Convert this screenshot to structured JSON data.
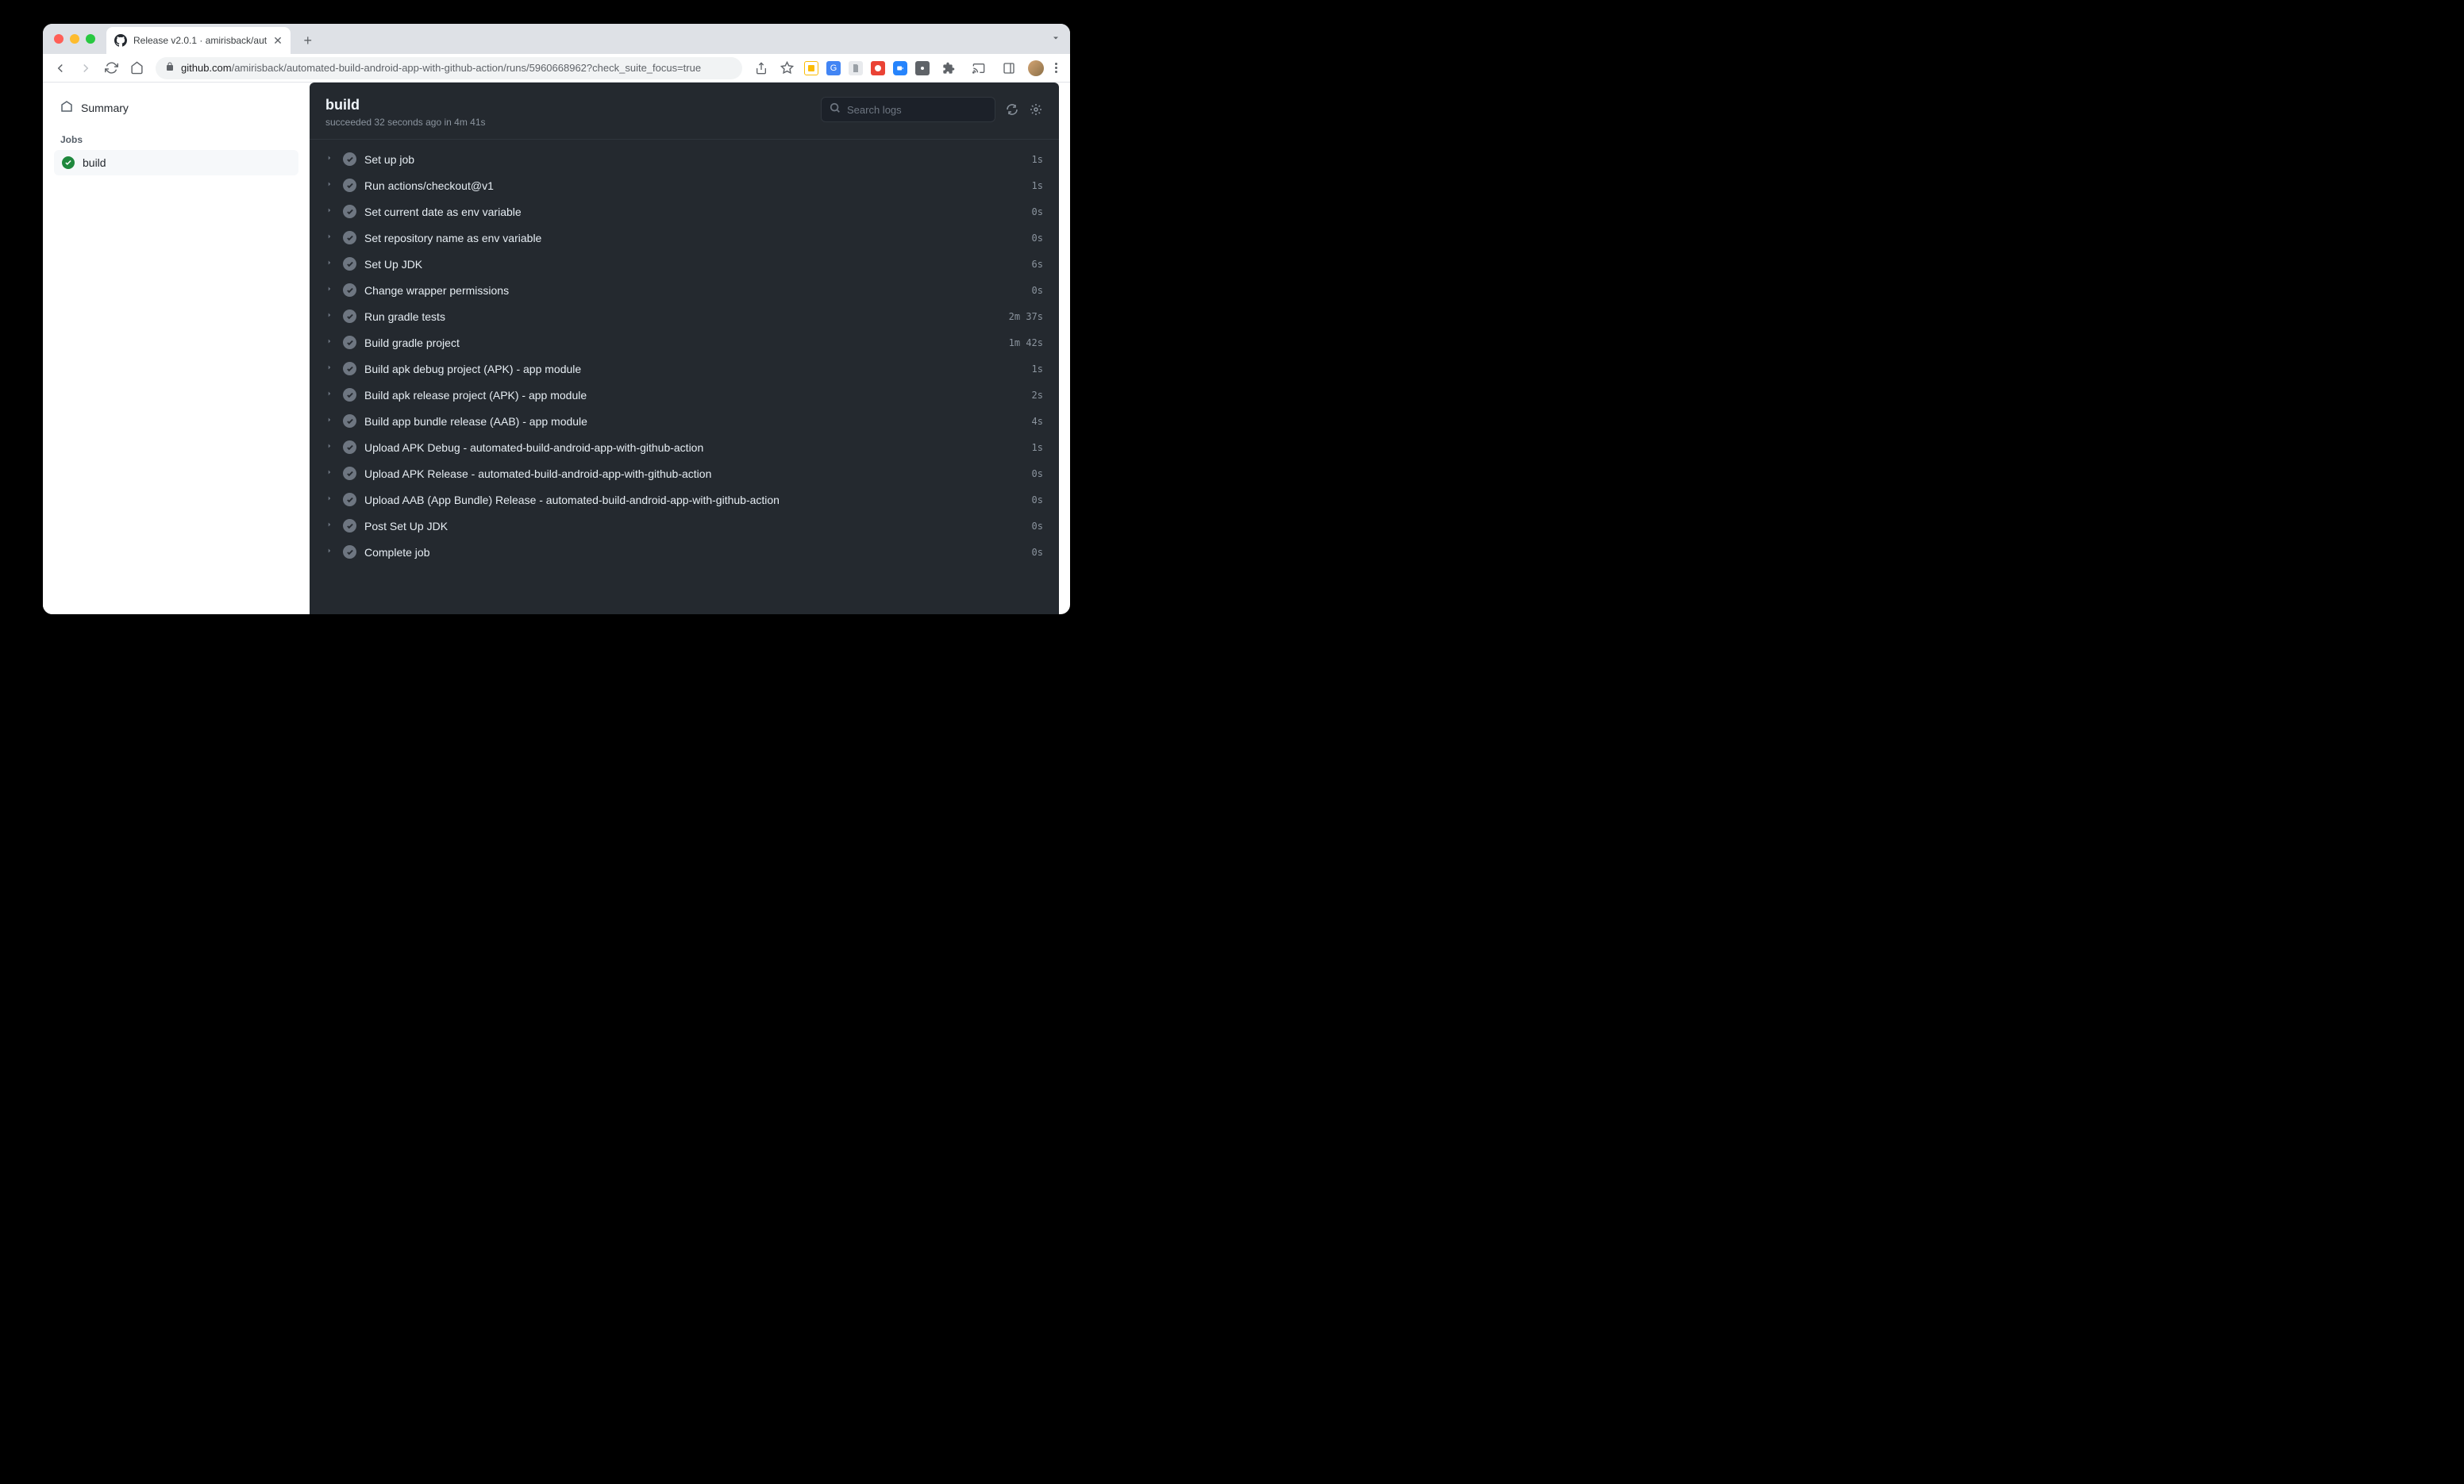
{
  "browser": {
    "tab_title": "Release v2.0.1 · amirisback/aut",
    "url_host": "github.com",
    "url_path": "/amirisback/automated-build-android-app-with-github-action/runs/5960668962?check_suite_focus=true"
  },
  "sidebar": {
    "summary_label": "Summary",
    "jobs_heading": "Jobs",
    "job_name": "build"
  },
  "job": {
    "title": "build",
    "status_prefix": "succeeded",
    "status_time": "32 seconds ago",
    "status_in": "in",
    "duration": "4m 41s",
    "search_placeholder": "Search logs"
  },
  "steps": [
    {
      "name": "Set up job",
      "time": "1s"
    },
    {
      "name": "Run actions/checkout@v1",
      "time": "1s"
    },
    {
      "name": "Set current date as env variable",
      "time": "0s"
    },
    {
      "name": "Set repository name as env variable",
      "time": "0s"
    },
    {
      "name": "Set Up JDK",
      "time": "6s"
    },
    {
      "name": "Change wrapper permissions",
      "time": "0s"
    },
    {
      "name": "Run gradle tests",
      "time": "2m 37s"
    },
    {
      "name": "Build gradle project",
      "time": "1m 42s"
    },
    {
      "name": "Build apk debug project (APK) - app module",
      "time": "1s"
    },
    {
      "name": "Build apk release project (APK) - app module",
      "time": "2s"
    },
    {
      "name": "Build app bundle release (AAB) - app module",
      "time": "4s"
    },
    {
      "name": "Upload APK Debug - automated-build-android-app-with-github-action",
      "time": "1s"
    },
    {
      "name": "Upload APK Release - automated-build-android-app-with-github-action",
      "time": "0s"
    },
    {
      "name": "Upload AAB (App Bundle) Release - automated-build-android-app-with-github-action",
      "time": "0s"
    },
    {
      "name": "Post Set Up JDK",
      "time": "0s"
    },
    {
      "name": "Complete job",
      "time": "0s"
    }
  ]
}
